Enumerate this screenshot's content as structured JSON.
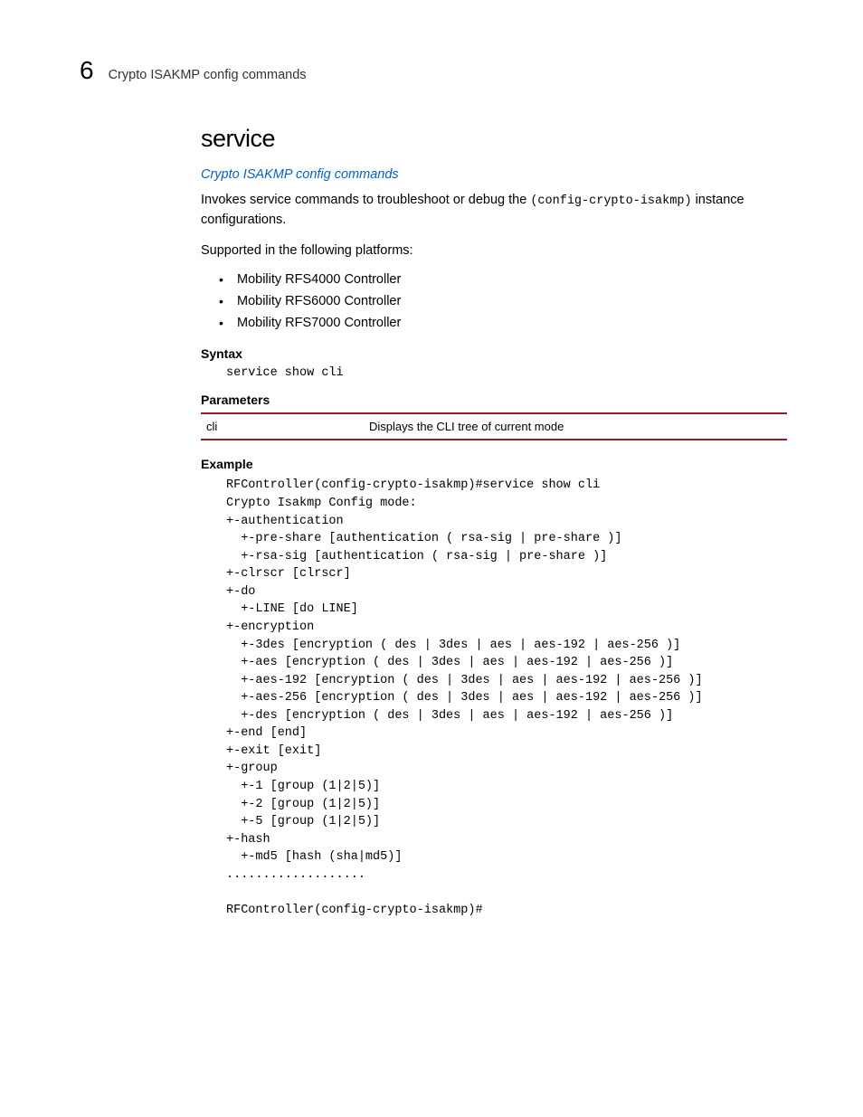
{
  "header": {
    "chapter_num": "6",
    "running_head": "Crypto ISAKMP config commands"
  },
  "main": {
    "title": "service",
    "breadcrumb_link": "Crypto ISAKMP config commands",
    "intro_pre": "Invokes service commands to troubleshoot or debug the ",
    "intro_code": "(config-crypto-isakmp)",
    "intro_post": " instance configurations.",
    "supported_text": "Supported in the following platforms:",
    "platforms": [
      "Mobility RFS4000 Controller",
      "Mobility RFS6000 Controller",
      "Mobility RFS7000 Controller"
    ],
    "syntax_head": "Syntax",
    "syntax_code": "service show cli",
    "parameters_head": "Parameters",
    "param_name": "cli",
    "param_desc": "Displays the CLI tree of current mode",
    "example_head": "Example",
    "example_code": "RFController(config-crypto-isakmp)#service show cli\nCrypto Isakmp Config mode:\n+-authentication\n  +-pre-share [authentication ( rsa-sig | pre-share )]\n  +-rsa-sig [authentication ( rsa-sig | pre-share )]\n+-clrscr [clrscr]\n+-do\n  +-LINE [do LINE]\n+-encryption\n  +-3des [encryption ( des | 3des | aes | aes-192 | aes-256 )]\n  +-aes [encryption ( des | 3des | aes | aes-192 | aes-256 )]\n  +-aes-192 [encryption ( des | 3des | aes | aes-192 | aes-256 )]\n  +-aes-256 [encryption ( des | 3des | aes | aes-192 | aes-256 )]\n  +-des [encryption ( des | 3des | aes | aes-192 | aes-256 )]\n+-end [end]\n+-exit [exit]\n+-group\n  +-1 [group (1|2|5)]\n  +-2 [group (1|2|5)]\n  +-5 [group (1|2|5)]\n+-hash\n  +-md5 [hash (sha|md5)]\n...................\n\nRFController(config-crypto-isakmp)#"
  }
}
